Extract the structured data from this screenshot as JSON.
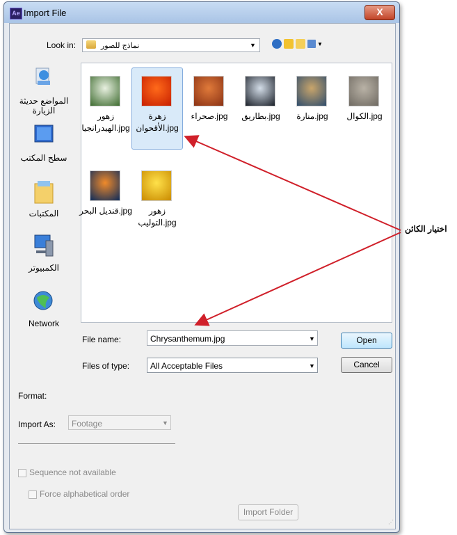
{
  "window": {
    "title": "Import File",
    "app_icon_text": "Ae",
    "close_label": "X"
  },
  "lookin": {
    "label": "Look in:",
    "value": "نماذج للصور"
  },
  "places": [
    {
      "label": "المواضع حديثة الزيارة",
      "icon": "recent-places-icon"
    },
    {
      "label": "سطح المكتب",
      "icon": "desktop-icon"
    },
    {
      "label": "المكتبات",
      "icon": "libraries-icon"
    },
    {
      "label": "الكمبيوتر",
      "icon": "computer-icon"
    },
    {
      "label": "Network",
      "icon": "network-icon"
    }
  ],
  "files": [
    {
      "line1": "jpg.الكوال",
      "line2": "",
      "colors": [
        "#b9b2a6",
        "#6f6a62"
      ]
    },
    {
      "line1": "jpg.منارة",
      "line2": "",
      "colors": [
        "#c9a56b",
        "#2f4d6c"
      ]
    },
    {
      "line1": "jpg.بطاريق",
      "line2": "",
      "colors": [
        "#d3dde8",
        "#1a1f28"
      ]
    },
    {
      "line1": "jpg.صحراء",
      "line2": "",
      "colors": [
        "#e07a3a",
        "#8a3215"
      ]
    },
    {
      "line1": "زهرة",
      "line2": "jpg.الأقحوان",
      "colors": [
        "#ff6a1a",
        "#c71f00"
      ],
      "selected": true
    },
    {
      "line1": "زهور",
      "line2": "jpg.الهيدرانجيا",
      "colors": [
        "#e8f0e0",
        "#3d6b2f"
      ]
    },
    {
      "line1": "jpg.قنديل البحر",
      "line2": "",
      "colors": [
        "#f08a2a",
        "#0b2a5a"
      ]
    },
    {
      "line1": "زهور",
      "line2": "jpg.التوليب",
      "colors": [
        "#ffe14a",
        "#c98a00"
      ]
    }
  ],
  "filename": {
    "label": "File name:",
    "value": "Chrysanthemum.jpg"
  },
  "filetype": {
    "label": "Files of type:",
    "value": "All Acceptable Files"
  },
  "buttons": {
    "open": "Open",
    "cancel": "Cancel",
    "import_folder": "Import Folder"
  },
  "options": {
    "format_label": "Format:",
    "import_as_label": "Import As:",
    "import_as_value": "Footage",
    "sequence_label": "Sequence not available",
    "force_alpha_label": "Force alphabetical order"
  },
  "annotation": {
    "text": "اختيار الكائن",
    "color": "#d0202a"
  }
}
